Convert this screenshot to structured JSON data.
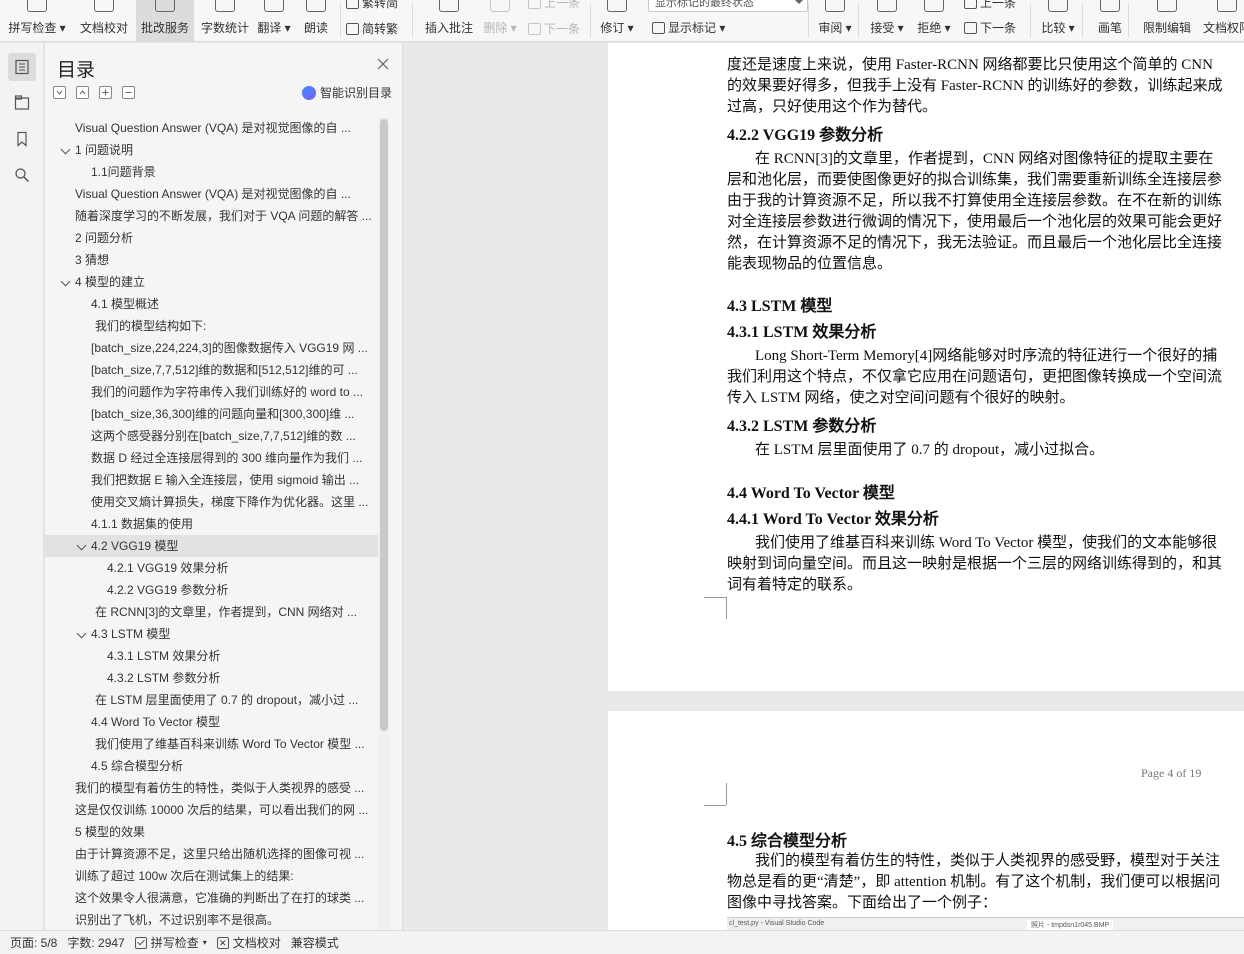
{
  "ribbon": {
    "buttons": [
      {
        "label": "拼写检查",
        "icon": "spellcheck-icon",
        "dropdown": true
      },
      {
        "label": "文档校对",
        "icon": "proofread-icon"
      },
      {
        "label": "批改服务",
        "icon": "correction-service-icon",
        "active": true
      },
      {
        "label": "字数统计",
        "icon": "word-count-icon"
      },
      {
        "label": "翻译",
        "icon": "translate-icon",
        "dropdown": true
      },
      {
        "label": "朗读",
        "icon": "read-aloud-icon"
      },
      {
        "label": "插入批注",
        "icon": "insert-comment-icon"
      },
      {
        "label": "删除",
        "icon": "delete-comment-icon",
        "dropdown": true,
        "disabled": true
      },
      {
        "label": "修订",
        "icon": "track-changes-icon",
        "dropdown": true
      },
      {
        "label": "审阅",
        "icon": "review-icon",
        "dropdown": true
      },
      {
        "label": "接受",
        "icon": "accept-icon",
        "dropdown": true
      },
      {
        "label": "拒绝",
        "icon": "reject-icon",
        "dropdown": true
      },
      {
        "label": "比较",
        "icon": "compare-icon",
        "dropdown": true
      },
      {
        "label": "画笔",
        "icon": "pen-icon"
      },
      {
        "label": "限制编辑",
        "icon": "restrict-edit-icon"
      },
      {
        "label": "文档权限",
        "icon": "doc-permission-icon"
      }
    ],
    "small": {
      "trad_to_simp": "繁转简",
      "simp_to_trad": "简转繁",
      "prev_comment": "上一条",
      "next_comment": "下一条",
      "show_markup": "显示标记",
      "markup_state": "显示标记的最终状态",
      "prev_change": "上一条",
      "next_change": "下一条"
    }
  },
  "nav": {
    "title": "目录",
    "smart_toc": "智能识别目录",
    "items": [
      {
        "text": "Visual Question Answer (VQA) 是对视觉图像的自 ...",
        "level": 0
      },
      {
        "text": "1  问题说明",
        "level": 0,
        "expanded": true
      },
      {
        "text": "1.1问题背景",
        "level": 1
      },
      {
        "text": "Visual Question Answer (VQA) 是对视觉图像的自 ...",
        "level": 0
      },
      {
        "text": "随着深度学习的不断发展，我们对于 VQA 问题的解答 ...",
        "level": 0
      },
      {
        "text": "2  问题分析",
        "level": 0
      },
      {
        "text": "3  猜想",
        "level": 0
      },
      {
        "text": "4  模型的建立",
        "level": 0,
        "expanded": true
      },
      {
        "text": "4.1  模型概述",
        "level": 1
      },
      {
        "text": "我们的模型结构如下:",
        "level": 2
      },
      {
        "text": "[batch_size,224,224,3]的图像数据传入 VGG19 网 ...",
        "level": 1
      },
      {
        "text": "[batch_size,7,7,512]维的数据和[512,512]维的可 ...",
        "level": 1
      },
      {
        "text": "我们的问题作为字符串传入我们训练好的 word to ...",
        "level": 1
      },
      {
        "text": "[batch_size,36,300]维的问题向量和[300,300]维 ...",
        "level": 1
      },
      {
        "text": "这两个感受器分别在[batch_size,7,7,512]维的数 ...",
        "level": 1
      },
      {
        "text": "数据 D 经过全连接层得到的 300 维向量作为我们 ...",
        "level": 1
      },
      {
        "text": "我们把数据 E 输入全连接层，使用 sigmoid 输出 ...",
        "level": 1
      },
      {
        "text": "使用交叉熵计算损失，梯度下降作为优化器。这里 ...",
        "level": 1
      },
      {
        "text": "4.1.1  数据集的使用",
        "level": 1
      },
      {
        "text": "4.2 VGG19 模型",
        "level": 1,
        "expanded": true,
        "selected": true
      },
      {
        "text": "4.2.1 VGG19  效果分析",
        "level": 3
      },
      {
        "text": "4.2.2 VGG19  参数分析",
        "level": 3
      },
      {
        "text": "在 RCNN[3]的文章里，作者提到，CNN 网络对 ...",
        "level": 2
      },
      {
        "text": "4.3 LSTM 模型",
        "level": 1,
        "expanded": true
      },
      {
        "text": "4.3.1 LSTM  效果分析",
        "level": 3
      },
      {
        "text": "4.3.2 LSTM  参数分析",
        "level": 3
      },
      {
        "text": "在 LSTM 层里面使用了 0.7 的 dropout，减小过 ...",
        "level": 2
      },
      {
        "text": "4.4 Word To Vector 模型",
        "level": 1
      },
      {
        "text": "我们使用了维基百科来训练 Word To Vector 模型 ...",
        "level": 2
      },
      {
        "text": "4.5  综合模型分析",
        "level": 1
      },
      {
        "text": "我们的模型有着仿生的特性，类似于人类视界的感受 ...",
        "level": 0
      },
      {
        "text": "这是仅仅训练 10000 次后的结果，可以看出我们的网 ...",
        "level": 0
      },
      {
        "text": "5  模型的效果",
        "level": 0
      },
      {
        "text": "由于计算资源不足，这里只给出随机选择的图像可视 ...",
        "level": 0
      },
      {
        "text": "训练了超过 100w 次后在测试集上的结果:",
        "level": 0
      },
      {
        "text": "这个效果令人很满意，它准确的判断出了在打的球类 ...",
        "level": 0
      },
      {
        "text": "识别出了飞机，不过识别率不是很高。",
        "level": 0
      }
    ]
  },
  "document": {
    "page1_lines": [
      {
        "text": "度还是速度上来说，使用 Faster-RCNN 网络都要比只使用这个简单的 CNN",
        "kind": "p"
      },
      {
        "text": "的效果要好得多，但我手上没有 Faster-RCNN 的训练好的参数，训练起来成",
        "kind": "p"
      },
      {
        "text": "过高，只好使用这个作为替代。",
        "kind": "p"
      },
      {
        "text": "4.2.2 VGG19  参数分析",
        "kind": "h"
      },
      {
        "text": "在 RCNN[3]的文章里，作者提到，CNN 网络对图像特征的提取主要在",
        "kind": "pi"
      },
      {
        "text": "层和池化层，而要使图像更好的拟合训练集，我们需要重新训练全连接层参",
        "kind": "p"
      },
      {
        "text": "由于我的计算资源不足，所以我不打算使用全连接层参数。在不在新的训练",
        "kind": "p"
      },
      {
        "text": "对全连接层参数进行微调的情况下，使用最后一个池化层的效果可能会更好",
        "kind": "p"
      },
      {
        "text": "然，在计算资源不足的情况下，我无法验证。而且最后一个池化层比全连接",
        "kind": "p"
      },
      {
        "text": "能表现物品的位置信息。",
        "kind": "p"
      },
      {
        "text": "4.3 LSTM 模型",
        "kind": "h"
      },
      {
        "text": "4.3.1 LSTM  效果分析",
        "kind": "h"
      },
      {
        "text": "Long Short-Term Memory[4]网络能够对时序流的特征进行一个很好的捕",
        "kind": "pi"
      },
      {
        "text": "我们利用这个特点，不仅拿它应用在问题语句，更把图像转换成一个空间流",
        "kind": "p"
      },
      {
        "text": "传入 LSTM 网络，使之对空间问题有个很好的映射。",
        "kind": "p"
      },
      {
        "text": "4.3.2 LSTM  参数分析",
        "kind": "h"
      },
      {
        "text": "在 LSTM 层里面使用了 0.7 的 dropout，减小过拟合。",
        "kind": "pi"
      },
      {
        "text": "4.4 Word To Vector 模型",
        "kind": "h"
      },
      {
        "text": "4.4.1 Word To Vector  效果分析",
        "kind": "h"
      },
      {
        "text": "我们使用了维基百科来训练 Word To Vector 模型，使我们的文本能够很",
        "kind": "pi"
      },
      {
        "text": "映射到词向量空间。而且这一映射是根据一个三层的网络训练得到的，和其",
        "kind": "p"
      },
      {
        "text": "词有着特定的联系。",
        "kind": "p"
      }
    ],
    "page2_header": "Page 4 of 19",
    "page2_lines": [
      {
        "text": "4.5  综合模型分析",
        "kind": "h"
      },
      {
        "text": "我们的模型有着仿生的特性，类似于人类视界的感受野，模型对于关注",
        "kind": "pi"
      },
      {
        "text": "物总是看的更“清楚”，即 attention 机制。有了这个机制，我们便可以根据问",
        "kind": "p"
      },
      {
        "text": "图像中寻找答案。下面给出了一个例子：",
        "kind": "p"
      }
    ],
    "embedded_caption_left": "cl_test.py - Visual Studio Code",
    "embedded_caption_right": "照片 - tmpdsn1r045.BMP"
  },
  "status": {
    "page": "页面: 5/8",
    "words": "字数: 2947",
    "spellcheck": "拼写检查",
    "proofread": "文档校对",
    "compat": "兼容模式"
  }
}
